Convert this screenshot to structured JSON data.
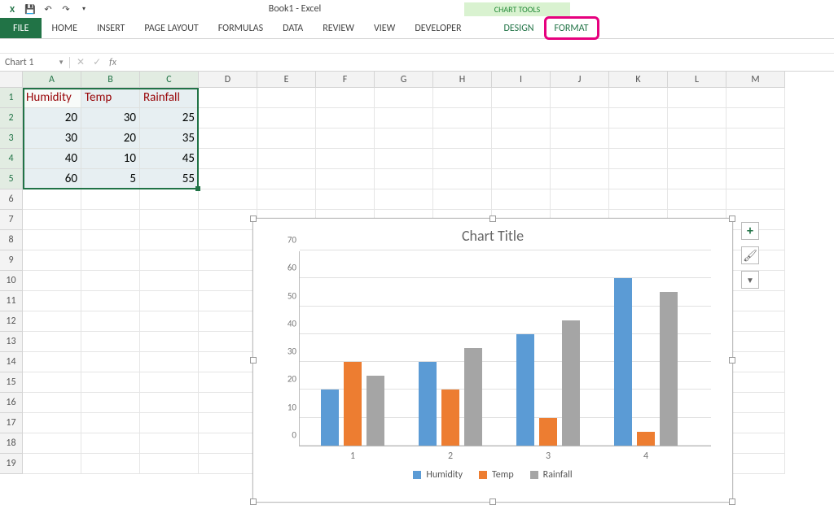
{
  "app": {
    "title": "Book1 - Excel",
    "chart_tools_label": "CHART TOOLS"
  },
  "qat_icons": {
    "save": "💾",
    "undo": "↶",
    "redo": "↷",
    "touch": "☰"
  },
  "ribbon": {
    "file": "FILE",
    "tabs": [
      "HOME",
      "INSERT",
      "PAGE LAYOUT",
      "FORMULAS",
      "DATA",
      "REVIEW",
      "VIEW",
      "DEVELOPER"
    ],
    "tool_tabs": [
      "DESIGN",
      "FORMAT"
    ],
    "highlighted": "FORMAT"
  },
  "formula_bar": {
    "name_box": "Chart 1",
    "fx": "fx",
    "value": ""
  },
  "grid": {
    "columns": [
      "A",
      "B",
      "C",
      "D",
      "E",
      "F",
      "G",
      "H",
      "I",
      "J",
      "K",
      "L",
      "M"
    ],
    "rows": 19,
    "headers": [
      "Humidity",
      "Temp",
      "Rainfall"
    ],
    "data": [
      [
        20,
        30,
        25
      ],
      [
        30,
        20,
        35
      ],
      [
        40,
        10,
        45
      ],
      [
        60,
        5,
        55
      ]
    ]
  },
  "chart_data": {
    "type": "bar",
    "title": "Chart Title",
    "categories": [
      "1",
      "2",
      "3",
      "4"
    ],
    "series": [
      {
        "name": "Humidity",
        "color": "#5b9bd5",
        "values": [
          20,
          30,
          40,
          60
        ]
      },
      {
        "name": "Temp",
        "color": "#ed7d31",
        "values": [
          30,
          20,
          10,
          5
        ]
      },
      {
        "name": "Rainfall",
        "color": "#a5a5a5",
        "values": [
          25,
          35,
          45,
          55
        ]
      }
    ],
    "ylim": [
      0,
      70
    ],
    "yticks": [
      0,
      10,
      20,
      30,
      40,
      50,
      60,
      70
    ],
    "xlabel": "",
    "ylabel": ""
  },
  "chart_side": {
    "plus": "+",
    "brush": "🖌",
    "filter": "▼"
  }
}
